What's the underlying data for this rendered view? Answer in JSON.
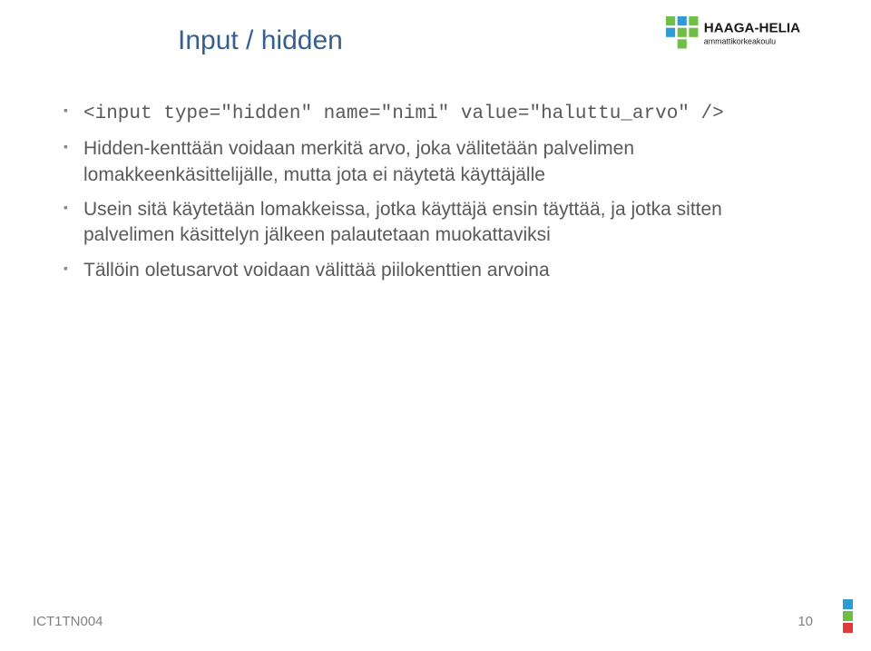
{
  "header": {
    "title": "Input / hidden",
    "logo_top": "HAAGA-HELIA",
    "logo_sub": "ammattikorkeakoulu"
  },
  "bullets": [
    {
      "text": "<input type=\"hidden\" name=\"nimi\" value=\"haluttu_arvo\" />",
      "mono": true
    },
    {
      "text": "Hidden-kenttään voidaan merkitä arvo, joka välitetään palvelimen lomakkeenkäsittelijälle, mutta jota ei näytetä käyttäjälle",
      "mono": false
    },
    {
      "text": "Usein sitä käytetään lomakkeissa, jotka käyttäjä ensin täyttää, ja jotka sitten palvelimen käsittelyn jälkeen palautetaan muokattaviksi",
      "mono": false
    },
    {
      "text": "Tällöin oletusarvot voidaan välittää piilokenttien arvoina",
      "mono": false
    }
  ],
  "footer": {
    "code": "ICT1TN004",
    "page": "10"
  },
  "corner_colors": [
    "#2e9bd6",
    "#6fbf44",
    "#e03a3a"
  ]
}
